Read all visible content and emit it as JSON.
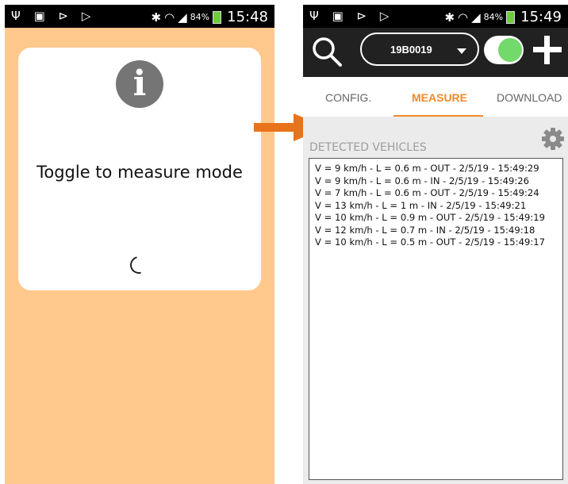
{
  "left_screen": {
    "statusbar": {
      "left_icons": "Ψ ▣ ⊳ ▷",
      "battery": "84%",
      "time": "15:48"
    },
    "dialog": {
      "icon": "info-icon",
      "message": "Toggle to measure mode",
      "spinner": "loading-spinner-icon"
    }
  },
  "arrow": {
    "icon": "arrow-right-icon",
    "color": "#e8731a"
  },
  "right_screen": {
    "statusbar": {
      "left_icons": "Ψ ▣ ⊳ ▷",
      "battery": "84%",
      "time": "15:49"
    },
    "toolbar": {
      "search_icon": "search-icon",
      "device_selected": "19B0019",
      "toggle_on": true,
      "add_icon": "plus-icon"
    },
    "tabs": [
      {
        "label": "CONFIG.",
        "active": false
      },
      {
        "label": "MEASURE",
        "active": true
      },
      {
        "label": "DOWNLOAD",
        "active": false
      }
    ],
    "section_title": "DETECTED VEHICLES",
    "settings_icon": "gear-icon",
    "vehicles": [
      "V = 9 km/h - L = 0.6 m - OUT - 2/5/19 - 15:49:29",
      "V = 9 km/h - L = 0.6 m - IN - 2/5/19 - 15:49:26",
      "V = 7 km/h - L = 0.6 m - OUT - 2/5/19 - 15:49:24",
      "V = 13 km/h - L = 1 m - IN - 2/5/19 - 15:49:21",
      "V = 10 km/h - L = 0.9 m - OUT - 2/5/19 - 15:49:19",
      "V = 12 km/h - L = 0.7 m - IN - 2/5/19 - 15:49:18",
      "V = 10 km/h - L = 0.5 m - OUT - 2/5/19 - 15:49:17"
    ]
  },
  "colors": {
    "accent": "#f08a2a",
    "left_bg": "#ffc88c",
    "toolbar_bg": "#212121",
    "toggle_knob": "#72d96a"
  }
}
